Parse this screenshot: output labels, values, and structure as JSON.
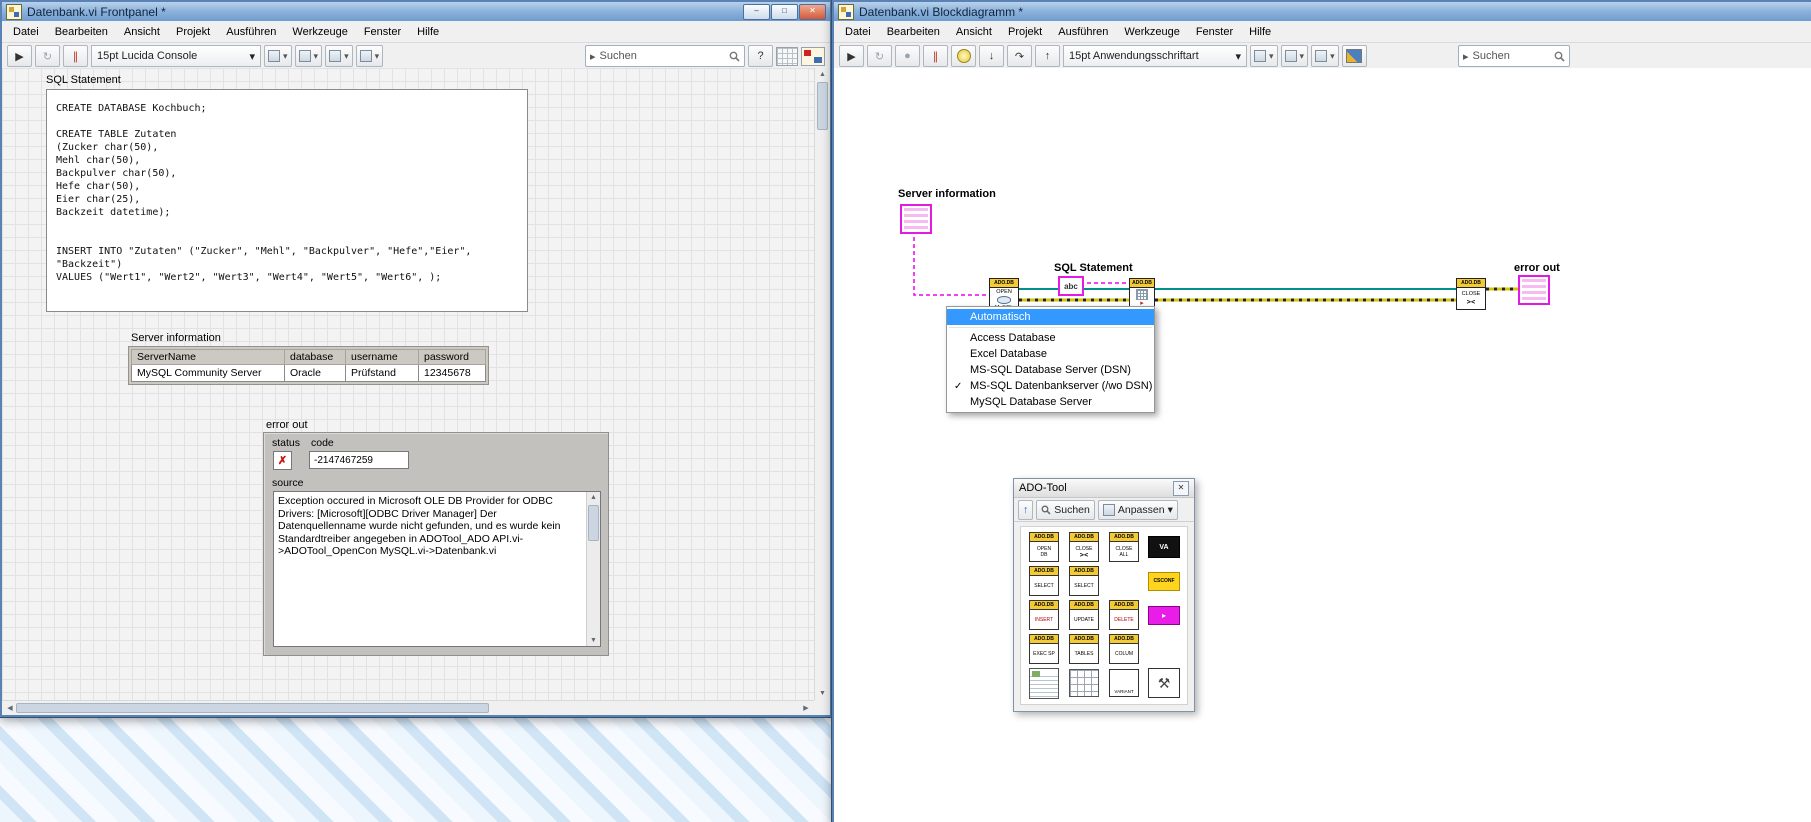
{
  "menu": [
    "Datei",
    "Bearbeiten",
    "Ansicht",
    "Projekt",
    "Ausführen",
    "Werkzeuge",
    "Fenster",
    "Hilfe"
  ],
  "colors": {
    "titlebar_blue": "#6f9bd0",
    "selection_blue": "#3399ff",
    "wire_string_magenta": "#f000f0",
    "wire_refnum_teal": "#008f8f",
    "wire_error_yellow": "#d6c400",
    "status_error_red": "#cc1111",
    "node_band_yellow": "#f4ca35"
  },
  "icons": {
    "run": "▶",
    "run_continuous": "↻",
    "pause": "∥",
    "abort": "●",
    "dropdown": "▾",
    "search_drop": "▸",
    "help": "?",
    "step_into": "↓",
    "step_over": "↷",
    "step_out": "↑",
    "win_min": "–",
    "win_max": "□",
    "win_close": "✕",
    "scroll_up": "▲",
    "scroll_down": "▼",
    "scroll_left": "◀",
    "scroll_right": "▶",
    "check": "✓",
    "status_x": "✗",
    "palette_up": "↑",
    "tools": "⚒",
    "db_close_glyph": "><",
    "exec_arrow": "▸"
  },
  "frontpanel": {
    "title": "Datenbank.vi Frontpanel *",
    "toolbar": {
      "font": "15pt Lucida Console",
      "search": "Suchen"
    },
    "sql": {
      "label": "SQL Statement",
      "text": "CREATE DATABASE Kochbuch;\n\nCREATE TABLE Zutaten\n(Zucker char(50),\nMehl char(50),\nBackpulver char(50),\nHefe char(50),\nEier char(25),\nBackzeit datetime);\n\n\nINSERT INTO \"Zutaten\" (\"Zucker\", \"Mehl\", \"Backpulver\", \"Hefe\",\"Eier\", \"Backzeit\")\nVALUES (\"Wert1\", \"Wert2\", \"Wert3\", \"Wert4\", \"Wert5\", \"Wert6\", );"
    },
    "server": {
      "label": "Server information",
      "headers": [
        "ServerName",
        "database",
        "username",
        "password"
      ],
      "values": [
        "MySQL Community Server",
        "Oracle",
        "Prüfstand",
        "12345678"
      ]
    },
    "error": {
      "label": "error out",
      "status_label": "status",
      "code_label": "code",
      "code_value": "-2147467259",
      "source_label": "source",
      "source_text": "Exception occured in Microsoft OLE DB Provider for ODBC Drivers: [Microsoft][ODBC Driver Manager] Der Datenquellenname wurde nicht gefunden, und es wurde kein Standardtreiber angegeben in ADOTool_ADO API.vi->ADOTool_OpenCon MySQL.vi->Datenbank.vi"
    }
  },
  "blockdiagram": {
    "title": "Datenbank.vi Blockdiagramm *",
    "toolbar": {
      "font": "15pt Anwendungsschriftart",
      "search": "Suchen"
    },
    "diagram": {
      "server_label": "Server information",
      "sql_label": "SQL Statement",
      "error_label": "error out",
      "abc": "abc",
      "node_open": {
        "band": "ADO.DB",
        "l1": "OPEN",
        "l2": "MySQL"
      },
      "node_exec": {
        "band": "ADO.DB"
      },
      "node_close": {
        "band": "ADO.DB",
        "l1": "CLOSE"
      }
    },
    "context_menu": {
      "items": [
        {
          "label": "Automatisch",
          "state": "selected"
        },
        {
          "label": "Access Database",
          "state": ""
        },
        {
          "label": "Excel Database",
          "state": ""
        },
        {
          "label": "MS-SQL Database Server (DSN)",
          "state": ""
        },
        {
          "label": "MS-SQL Datenbankserver (/wo DSN)",
          "state": "checked"
        },
        {
          "label": "MySQL Database Server",
          "state": ""
        }
      ]
    },
    "palette": {
      "title": "ADO-Tool",
      "search": "Suchen",
      "customize": "Anpassen",
      "icons": [
        {
          "band": "ADO.DB",
          "l1": "OPEN",
          "l2": "DB"
        },
        {
          "band": "ADO.DB",
          "l1": "CLOSE",
          "l2": ""
        },
        {
          "band": "ADO.DB",
          "l1": "CLOSE",
          "l2": "ALL"
        },
        {
          "band": "",
          "l1": "VA",
          "l2": ""
        },
        {
          "band": "ADO.DB",
          "l1": "SELECT",
          "l2": ""
        },
        {
          "band": "ADO.DB",
          "l1": "SELECT",
          "l2": ""
        },
        {
          "band": "",
          "l1": "CSCONF",
          "l2": ""
        },
        {
          "band": "ADO.DB",
          "l1": "INSERT",
          "l2": ""
        },
        {
          "band": "ADO.DB",
          "l1": "UPDATE",
          "l2": ""
        },
        {
          "band": "ADO.DB",
          "l1": "DELETE",
          "l2": ""
        },
        {
          "band": "ADO.DB",
          "l1": "EXEC SP",
          "l2": ""
        },
        {
          "band": "ADO.DB",
          "l1": "TABLES",
          "l2": ""
        },
        {
          "band": "ADO.DB",
          "l1": "COLUM",
          "l2": ""
        },
        {
          "band": "",
          "l1": "VARIANT",
          "l2": ""
        }
      ]
    }
  }
}
